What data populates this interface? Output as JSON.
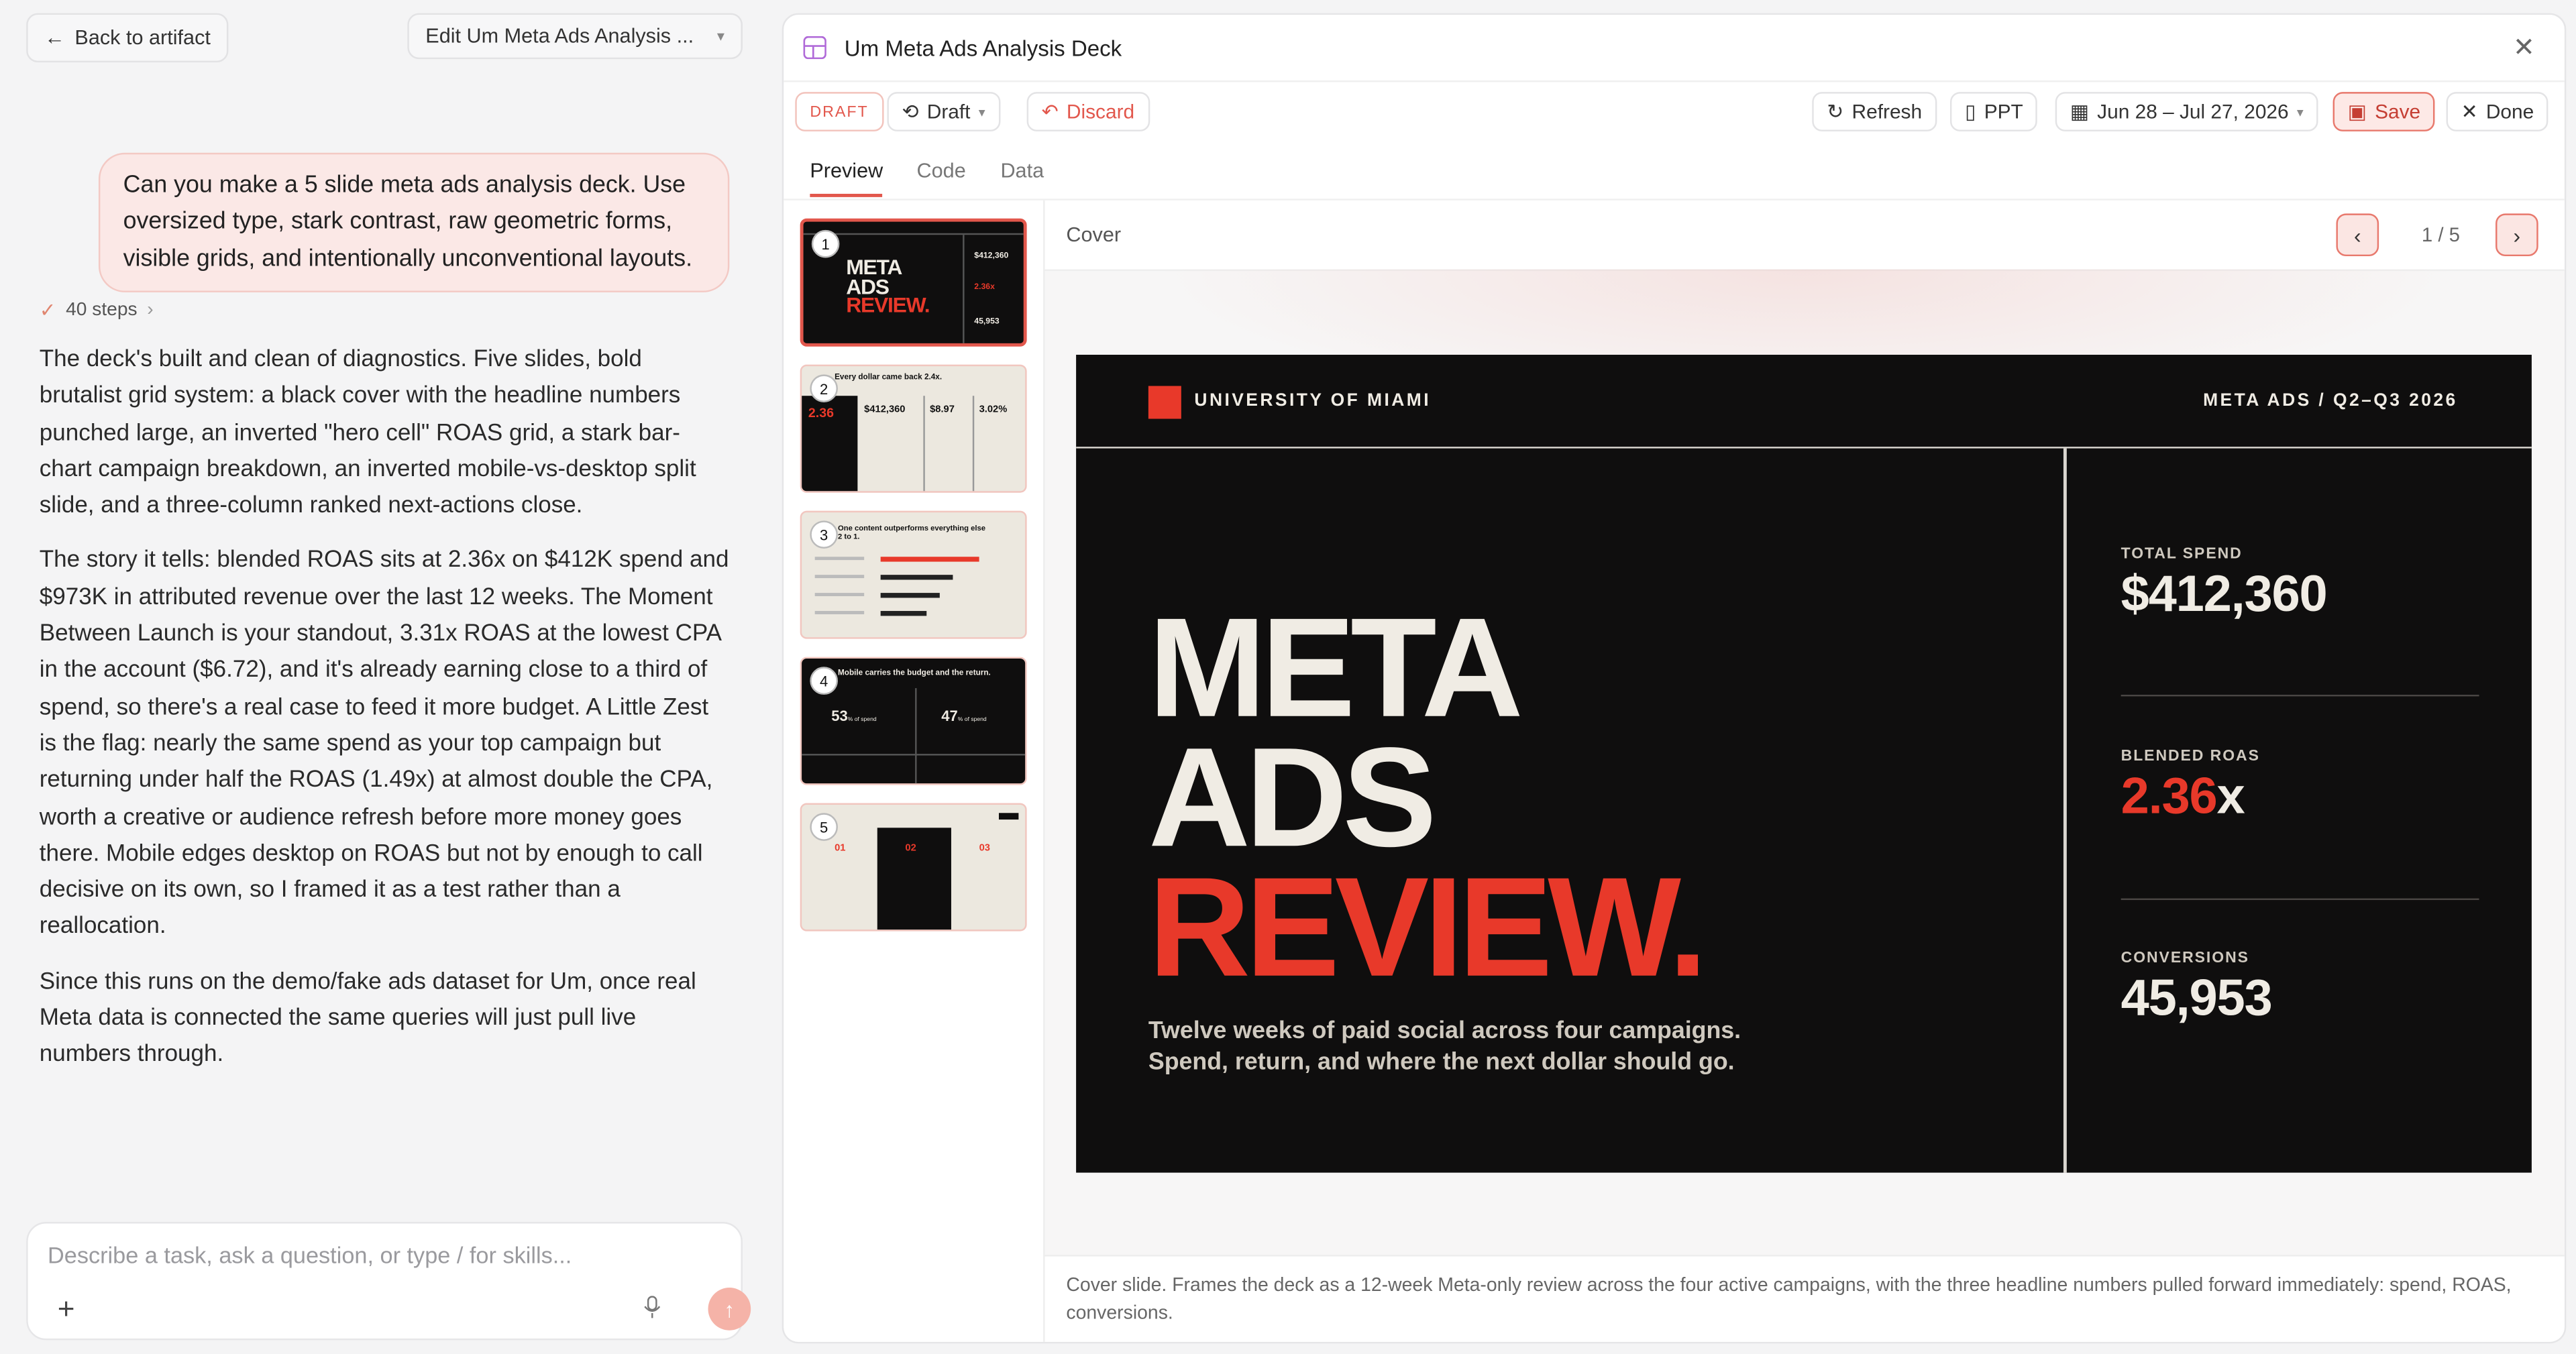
{
  "chat": {
    "back_label": "Back to artifact",
    "edit_label": "Edit Um Meta Ads Analysis ...",
    "user_message": "Can you make a 5 slide meta ads analysis deck. Use oversized type, stark contrast, raw geometric forms, visible grids, and intentionally unconventional layouts.",
    "steps_label": "40 steps",
    "reply_paragraphs": [
      "The deck's built and clean of diagnostics. Five slides, bold brutalist grid system: a black cover with the headline numbers punched large, an inverted \"hero cell\" ROAS grid, a stark bar-chart campaign breakdown, an inverted mobile-vs-desktop split slide, and a three-column ranked next-actions close.",
      "The story it tells: blended ROAS sits at 2.36x on $412K spend and $973K in attributed revenue over the last 12 weeks. The Moment Between Launch is your standout, 3.31x ROAS at the lowest CPA in the account ($6.72), and it's already earning close to a third of spend, so there's a real case to feed it more budget. A Little Zest is the flag: nearly the same spend as your top campaign but returning under half the ROAS (1.49x) at almost double the CPA, worth a creative or audience refresh before more money goes there. Mobile edges desktop on ROAS but not by enough to call decisive on its own, so I framed it as a test rather than a reallocation.",
      "Since this runs on the demo/fake ads dataset for Um, once real Meta data is connected the same queries will just pull live numbers through."
    ],
    "composer_placeholder": "Describe a task, ask a question, or type / for skills..."
  },
  "artifact": {
    "title": "Um Meta Ads Analysis Deck",
    "toolbar": {
      "status_tag": "DRAFT",
      "version_label": "Draft",
      "discard_label": "Discard",
      "refresh_label": "Refresh",
      "ppt_label": "PPT",
      "date_range": "Jun 28 – Jul 27, 2026",
      "save_label": "Save",
      "done_label": "Done"
    },
    "tabs": [
      "Preview",
      "Code",
      "Data"
    ],
    "active_tab": "Preview",
    "thumbnails": [
      {
        "num": "1"
      },
      {
        "num": "2"
      },
      {
        "num": "3"
      },
      {
        "num": "4"
      },
      {
        "num": "5"
      }
    ],
    "thumb_text": {
      "t1_line1": "META",
      "t1_line2": "ADS",
      "t1_line3": "REVIEW.",
      "t1_v1": "$412,360",
      "t1_v2": "2.36x",
      "t1_v3": "45,953",
      "t2_title": "Every dollar came back 2.4x.",
      "t2_c1": "2.36",
      "t2_c2": "$412,360",
      "t2_c3": "$8.97",
      "t2_c4": "3.02%",
      "t3_title": "One content outperforms everything else 2 to 1.",
      "t4_title": "Mobile carries the budget and the return.",
      "t4_l": "53",
      "t4_r": "47",
      "t4_suffix": "% of spend",
      "t5_c1": "01",
      "t5_c2": "02",
      "t5_c3": "03"
    },
    "viewer": {
      "slide_label": "Cover",
      "page_indicator": "1 / 5",
      "caption": "Cover slide. Frames the deck as a 12-week Meta-only review across the four active campaigns, with the three headline numbers pulled forward immediately: spend, ROAS, conversions."
    },
    "slide": {
      "org": "UNIVERSITY OF MIAMI",
      "tag": "META ADS / Q2–Q3 2026",
      "headline_1": "META",
      "headline_2": "ADS",
      "headline_3": "REVIEW.",
      "subtitle_1": "Twelve weeks of paid social across four campaigns.",
      "subtitle_2": "Spend, return, and where the next dollar should go.",
      "stats": [
        {
          "label": "TOTAL SPEND",
          "value": "$412,360"
        },
        {
          "label": "BLENDED ROAS",
          "value": "2.36",
          "suffix": "x"
        },
        {
          "label": "CONVERSIONS",
          "value": "45,953"
        }
      ]
    }
  },
  "colors": {
    "accent": "#e2574c",
    "slide_red": "#e8392a",
    "slide_bg": "#0f0e0e",
    "slide_cream": "#f0ece4"
  }
}
